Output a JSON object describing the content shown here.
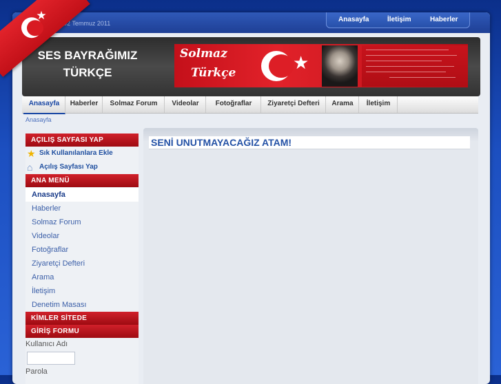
{
  "top": {
    "date": "Cumartesi, 02 Temmuz 2011",
    "links": [
      "Anasayfa",
      "İletişim",
      "Haberler"
    ]
  },
  "header": {
    "title_line1": "SES BAYRAĞIMIZ",
    "title_line2": "TÜRKÇE",
    "banner_word1": "Solmaz",
    "banner_word2": "Türkçe"
  },
  "nav": {
    "items": [
      "Anasayfa",
      "Haberler",
      "Solmaz Forum",
      "Videolar",
      "Fotoğraflar",
      "Ziyaretçi Defteri",
      "Arama",
      "İletişim"
    ],
    "active": "Anasayfa"
  },
  "breadcrumb": "Anasayfa",
  "sidebar": {
    "homepage_head": "AÇILIŞ SAYFASI YAP",
    "fav_link": "Sık Kullanılanlara Ekle",
    "homepage_link": "Açılış Sayfası Yap",
    "menu_head": "ANA MENÜ",
    "menu": [
      "Anasayfa",
      "Haberler",
      "Solmaz Forum",
      "Videolar",
      "Fotoğraflar",
      "Ziyaretçi Defteri",
      "Arama",
      "İletişim",
      "Denetim Masası"
    ],
    "online_head": "KİMLER SİTEDE",
    "login_head": "GİRİŞ FORMU",
    "username_label": "Kullanıcı Adı",
    "password_label": "Parola"
  },
  "article": {
    "title": "SENİ UNUTMAYACAĞIZ ATAM!"
  },
  "colors": {
    "accent": "#1846a3",
    "red": "#c8151e",
    "page_bg": "#1c4fc0"
  }
}
